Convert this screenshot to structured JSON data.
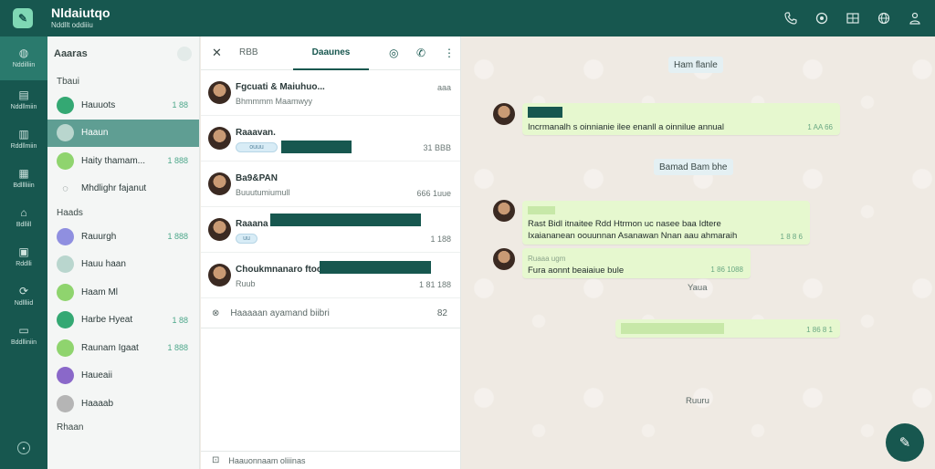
{
  "header": {
    "logo_glyph": "✎",
    "title": "Nldaiutqo",
    "subtitle": "Nddllt oddiiiu",
    "icons": [
      "phone-icon",
      "refresh-icon",
      "grid-icon",
      "globe-icon",
      "person-icon"
    ]
  },
  "rail": {
    "items": [
      {
        "label": "Nddilliin",
        "icon": "chat-icon"
      },
      {
        "label": "Nddllmiin",
        "icon": "status-icon"
      },
      {
        "label": "Rddllmiin",
        "icon": "channels-icon"
      },
      {
        "label": "Bdlllliiin",
        "icon": "communities-icon"
      },
      {
        "label": "Bdllill",
        "icon": "tools-icon"
      },
      {
        "label": "Rddlli",
        "icon": "calls-icon"
      },
      {
        "label": "Ndllliid",
        "icon": "starred-icon"
      },
      {
        "label": "Bddlliniin",
        "icon": "archive-icon"
      }
    ]
  },
  "sidebar": {
    "title": "Aaaras",
    "section1": "Tbaui",
    "items1": [
      {
        "label": "Hauuots",
        "count": "1 88",
        "color": "#34a873"
      },
      {
        "label": "Haaun",
        "count": "",
        "color": "#b9d6ce"
      },
      {
        "label": "Haity thamam...",
        "count": "1 888",
        "color": "#8fd46e"
      }
    ],
    "folder_label": "Mhdlighr fajanut",
    "section2": "Haads",
    "items2": [
      {
        "label": "Rauurgh",
        "count": "1 888",
        "color": "#8f8fe0"
      },
      {
        "label": "Hauu haan",
        "count": "",
        "color": "#b9d6ce"
      },
      {
        "label": "Haam Ml",
        "count": "",
        "color": "#8fd46e"
      },
      {
        "label": "Harbe Hyeat",
        "count": "1 88",
        "color": "#34a873"
      },
      {
        "label": "Raunam Igaat",
        "count": "1 888",
        "color": "#8fd46e"
      },
      {
        "label": "Haueaii",
        "count": "",
        "color": "#8a68c9"
      },
      {
        "label": "Haaaab",
        "count": "",
        "color": "#b5b5b5"
      }
    ],
    "section3": "Rhaan"
  },
  "chatlist": {
    "close_glyph": "✕",
    "tab1": "RBB",
    "tab2": "Daaunes",
    "chats": [
      {
        "name": "Fgcuati & Maiuhuo...",
        "sub": "Bhmmmm Maamwyy",
        "time": "aaa",
        "badge": ""
      },
      {
        "name": "Raaavan.",
        "sub": "",
        "time": "31 BBB",
        "badge": "ouuu"
      },
      {
        "name": "Ba9&PAN",
        "sub": "Buuutumiumull",
        "time": "666 1uue",
        "badge": ""
      },
      {
        "name": "Raaana",
        "sub": "",
        "time": "1 188",
        "badge": "uu"
      },
      {
        "name": "Choukmnanaro ftoon...",
        "sub": "Ruub",
        "time": "1 81 188",
        "badge": ""
      }
    ],
    "archived_icon": "⊗",
    "archived_label": "Haaaaan ayamand biibri",
    "archived_count": "82",
    "footer_icon": "⊡",
    "footer_label": "Haauonnaam oliiinas"
  },
  "conversation": {
    "day1": "Ham flanle",
    "msg1_text": "Incrmanalh s oinnianie ilee enanll a oinnilue annual",
    "msg1_time": "1 AA 66",
    "day2": "Bamad Bam bhe",
    "msg2_text1": "Rast Bidl itnaitee Rdd Htrmon uc nasee baa Idtere",
    "msg2_text2": "Ixaiananean oouunnan Asanawan Nnan aau ahmaraih",
    "msg2_time": "1 8 8 6",
    "msg3_name": "Ruaaa ugm",
    "msg3_text": "Fura aonnt beaiaiue bule",
    "msg3_time": "1 86 1088",
    "label_a": "Yaua",
    "msg4_time": "1 86 8 1",
    "label_b": "Ruuru",
    "fab_icon": "compose-icon"
  }
}
